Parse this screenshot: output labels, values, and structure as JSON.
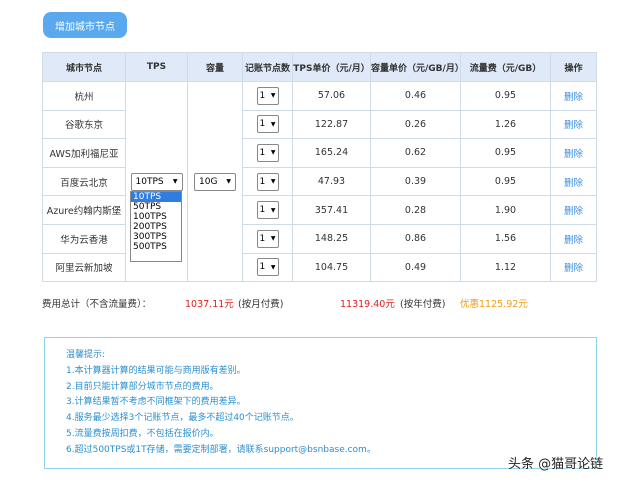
{
  "toolbar": {
    "add_label": "增加城市节点"
  },
  "table": {
    "headers": [
      "城市节点",
      "TPS",
      "容量",
      "记账节点数",
      "TPS单价（元/月）",
      "容量单价（元/GB/月）",
      "流量费（元/GB）",
      "操作"
    ],
    "tps_selected": "10TPS",
    "capacity_selected": "10G",
    "rows": [
      {
        "city": "杭州",
        "nodes": "1",
        "tps_price": "57.06",
        "cap_price": "0.46",
        "traffic": "0.95",
        "action": "删除"
      },
      {
        "city": "谷歌东京",
        "nodes": "1",
        "tps_price": "122.87",
        "cap_price": "0.26",
        "traffic": "1.26",
        "action": "删除"
      },
      {
        "city": "AWS加利福尼亚",
        "nodes": "1",
        "tps_price": "165.24",
        "cap_price": "0.62",
        "traffic": "0.95",
        "action": "删除"
      },
      {
        "city": "百度云北京",
        "nodes": "1",
        "tps_price": "47.93",
        "cap_price": "0.39",
        "traffic": "0.95",
        "action": "删除"
      },
      {
        "city": "Azure约翰内斯堡",
        "nodes": "1",
        "tps_price": "357.41",
        "cap_price": "0.28",
        "traffic": "1.90",
        "action": "删除"
      },
      {
        "city": "华为云香港",
        "nodes": "1",
        "tps_price": "148.25",
        "cap_price": "0.86",
        "traffic": "1.56",
        "action": "删除"
      },
      {
        "city": "阿里云新加坡",
        "nodes": "1",
        "tps_price": "104.75",
        "cap_price": "0.49",
        "traffic": "1.12",
        "action": "删除"
      }
    ]
  },
  "tps_dropdown": {
    "options": [
      "10TPS",
      "50TPS",
      "100TPS",
      "200TPS",
      "300TPS",
      "500TPS"
    ],
    "selected": "10TPS"
  },
  "totals": {
    "label": "费用总计（不含流量费）：",
    "monthly_amount": "1037.11元",
    "monthly_label": "(按月付费)",
    "yearly_amount": "11319.40元",
    "yearly_label": "(按年付费)",
    "discount": "优惠1125.92元"
  },
  "tips": {
    "title": "温馨提示:",
    "lines": [
      "1.本计算器计算的结果可能与商用版有差别。",
      "2.目前只能计算部分城市节点的费用。",
      "3.计算结果暂不考虑不同框架下的费用差异。",
      "4.服务最少选择3个记账节点，最多不超过40个记账节点。",
      "5.流量费按周扣费，不包括在报价内。",
      "6.超过500TPS或1T存储，需要定制部署，请联系support@bsnbase.com。"
    ]
  },
  "watermark": "头条 @猫哥论链",
  "colors": {
    "button": "#5aa9ef",
    "header_bg": "#dfe9f7",
    "link": "#3c8ee2",
    "price_red": "#e02020",
    "discount_orange": "#f39c12",
    "tips_text": "#2a8fd0"
  }
}
